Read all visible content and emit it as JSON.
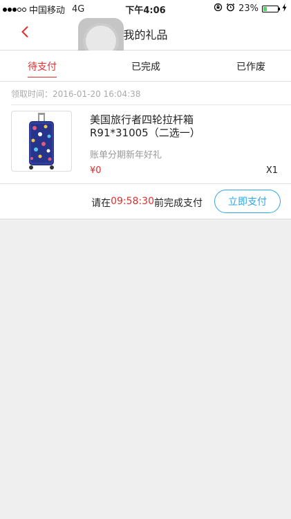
{
  "status_bar": {
    "carrier": "中国移动",
    "network": "4G",
    "time": "下午4:06",
    "battery": "23%",
    "battery_level": 0.23
  },
  "nav": {
    "title": "我的礼品",
    "back_icon": "chevron-left-icon"
  },
  "tabs": [
    {
      "label": "待支付",
      "active": true
    },
    {
      "label": "已完成",
      "active": false
    },
    {
      "label": "已作废",
      "active": false
    }
  ],
  "order": {
    "claim_time": "领取时间：2016-01-20 16:04:38",
    "product": {
      "name_line1": "美国旅行者四轮拉杆箱",
      "name_line2": "R91*31005（二选一）",
      "subtitle": "账单分期新年好礼",
      "price": "¥0",
      "quantity": "X1",
      "image_icon": "suitcase-image"
    },
    "payment": {
      "prefix": "请在",
      "countdown": "09:58:30",
      "suffix": "前完成支付",
      "button_label": "立即支付"
    }
  },
  "colors": {
    "accent_red": "#e02d2d",
    "accent_blue": "#2fa4e7",
    "background": "#efeff0"
  }
}
